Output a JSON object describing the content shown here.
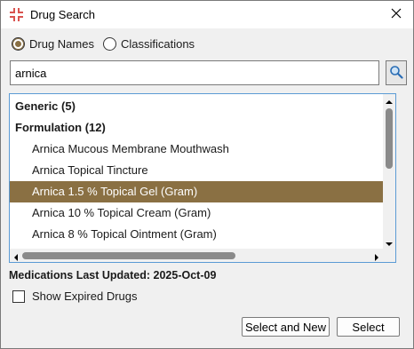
{
  "window": {
    "title": "Drug Search",
    "app_icon": "plus-cross-icon",
    "close_icon": "close-icon"
  },
  "search_mode": {
    "options": [
      {
        "label": "Drug Names",
        "checked": true
      },
      {
        "label": "Classifications",
        "checked": false
      }
    ]
  },
  "search": {
    "value": "arnica",
    "button_icon": "magnifier-icon"
  },
  "results": {
    "rows": [
      {
        "type": "group",
        "label": "Generic (5)"
      },
      {
        "type": "group",
        "label": "Formulation (12)"
      },
      {
        "type": "item",
        "label": "Arnica  Mucous Membrane Mouthwash"
      },
      {
        "type": "item",
        "label": "Arnica  Topical Tincture"
      },
      {
        "type": "item",
        "label": "Arnica 1.5 % Topical Gel (Gram)",
        "selected": true
      },
      {
        "type": "item",
        "label": "Arnica 10 % Topical Cream (Gram)"
      },
      {
        "type": "item",
        "label": "Arnica 8 % Topical Ointment (Gram)"
      }
    ]
  },
  "footer": {
    "updated_text": "Medications Last Updated: 2025-Oct-09",
    "show_expired_label": "Show Expired Drugs",
    "show_expired_checked": false,
    "select_new_label": "Select and New",
    "select_label": "Select"
  },
  "colors": {
    "selection": "#8a7043",
    "list_border": "#5b9bd5",
    "app_icon": "#d9534f"
  }
}
